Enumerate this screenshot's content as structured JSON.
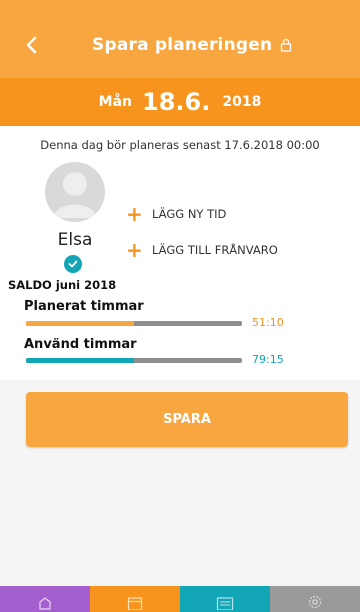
{
  "header": {
    "title": "Spara planeringen"
  },
  "date_bar": {
    "weekday": "Mån",
    "date": "18.6.",
    "year": "2018"
  },
  "deadline_text": "Denna dag bör planeras senast 17.6.2018 00:00",
  "user": {
    "name": "Elsa"
  },
  "actions": {
    "add_time": "LÄGG NY TID",
    "add_absence": "LÄGG TILL FRÅNVARO"
  },
  "saldo_label": "SALDO juni 2018",
  "rows": [
    {
      "title": "Planerat timmar",
      "value": "51:10",
      "fill": 0.5
    },
    {
      "title": "Använd timmar",
      "value": "79:15",
      "fill": 0.5
    }
  ],
  "save_label": "SPARA",
  "colors": {
    "accent_orange": "#f8a640",
    "date_orange": "#f7941d",
    "teal": "#12a5b5",
    "purple": "#a45fcf",
    "grey": "#9a9a9a"
  },
  "tabs": [
    {
      "icon": "home-icon"
    },
    {
      "icon": "calendar-icon"
    },
    {
      "icon": "list-icon"
    },
    {
      "icon": "gear-icon"
    }
  ]
}
